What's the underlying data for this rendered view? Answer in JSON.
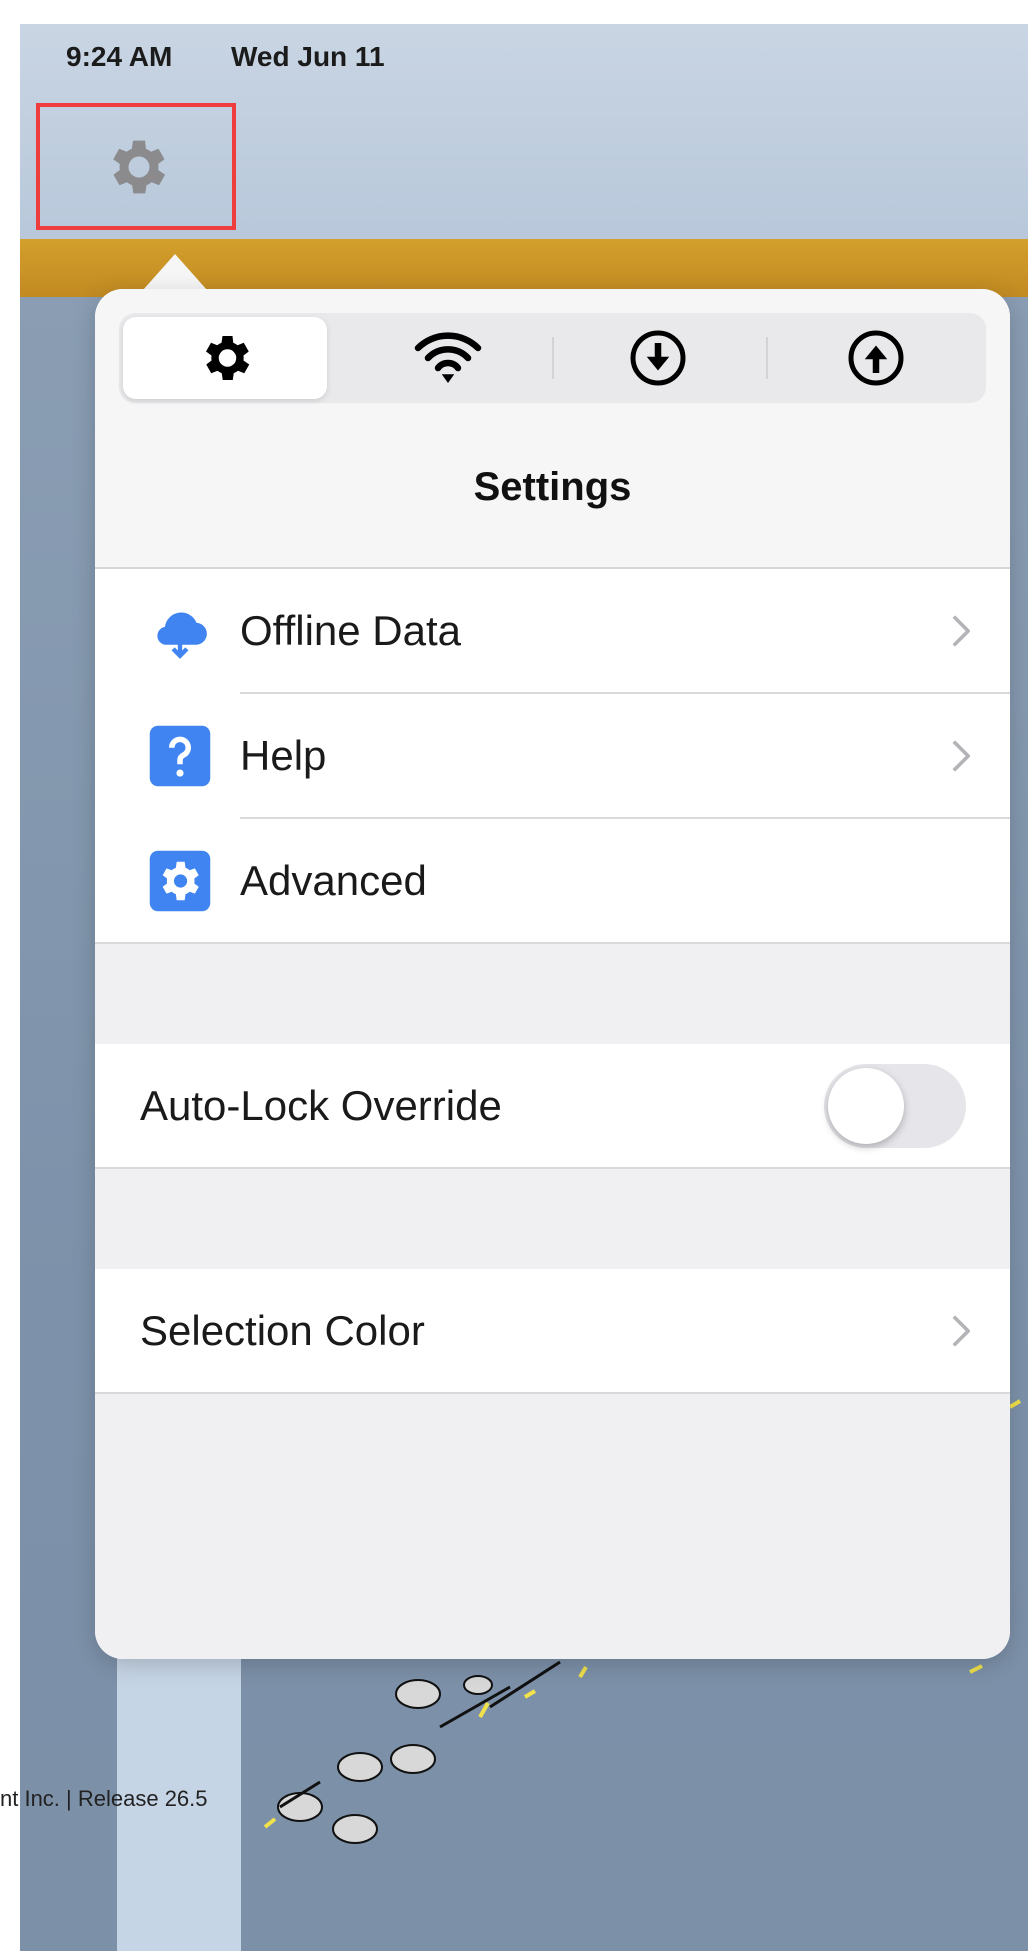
{
  "status_bar": {
    "time": "9:24 AM",
    "date": "Wed Jun 11"
  },
  "popover": {
    "title": "Settings",
    "tabs": [
      {
        "icon": "gear-icon",
        "selected": true
      },
      {
        "icon": "wifi-icon",
        "selected": false
      },
      {
        "icon": "download-circle-icon",
        "selected": false
      },
      {
        "icon": "upload-circle-icon",
        "selected": false
      }
    ],
    "menu": [
      {
        "label": "Offline Data",
        "icon": "cloud-download-icon",
        "chevron": true
      },
      {
        "label": "Help",
        "icon": "question-mark-icon",
        "chevron": true
      },
      {
        "label": "Advanced",
        "icon": "settings-box-icon",
        "chevron": false
      }
    ],
    "auto_lock": {
      "label": "Auto-Lock Override",
      "enabled": false
    },
    "selection_color": {
      "label": "Selection Color"
    }
  },
  "footer": {
    "copyright": "nt Inc.  |  Release 26.5"
  },
  "colors": {
    "accent_blue": "#3f84f0",
    "highlight_red": "#ef3d3d",
    "gold_bar": "#c9922a"
  }
}
